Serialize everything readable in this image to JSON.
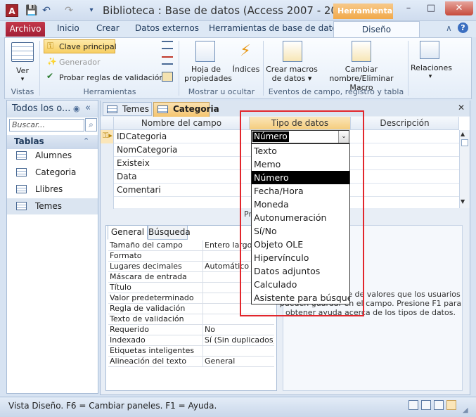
{
  "titlebar": {
    "title": "Biblioteca : Base de datos (Access 2007 - 2010)",
    "context_tab": "Herramienta...",
    "app_icon_letter": "A"
  },
  "ribbon_tabs": [
    "Archivo",
    "Inicio",
    "Crear",
    "Datos externos",
    "Herramientas de base de datos",
    "Diseño"
  ],
  "ribbon": {
    "ver": "Ver",
    "clave_principal": "Clave principal",
    "generador": "Generador",
    "probar_reglas": "Probar reglas de validación",
    "hoja_propiedades": [
      "Hoja de",
      "propiedades"
    ],
    "indices": "Índices",
    "crear_macros": [
      "Crear macros",
      "de datos ▾"
    ],
    "cambiar_macro": [
      "Cambiar",
      "nombre/Eliminar Macro"
    ],
    "relaciones": "Relaciones",
    "groups": [
      "Vistas",
      "Herramientas",
      "Mostrar u ocultar",
      "Eventos de campo, registro y tabla"
    ]
  },
  "nav": {
    "title": "Todos los o...",
    "search_placeholder": "Buscar...",
    "section": "Tablas",
    "items": [
      "Alumnes",
      "Categoria",
      "Llibres",
      "Temes"
    ]
  },
  "doc_tabs": [
    "Temes",
    "Categoria"
  ],
  "grid": {
    "headers": [
      "Nombre del campo",
      "Tipo de datos",
      "Descripción"
    ],
    "fields": [
      "IDCategoria",
      "NomCategoria",
      "Existeix",
      "Data",
      "Comentari"
    ],
    "current_type": "Número",
    "partial_label": "Pr"
  },
  "dropdown_options": [
    "Texto",
    "Memo",
    "Número",
    "Fecha/Hora",
    "Moneda",
    "Autonumeración",
    "Sí/No",
    "Objeto OLE",
    "Hipervínculo",
    "Datos adjuntos",
    "Calculado",
    "Asistente para búsque"
  ],
  "props": {
    "tabs": [
      "General",
      "Búsqueda"
    ],
    "rows": [
      {
        "label": "Tamaño del campo",
        "value": "Entero largo"
      },
      {
        "label": "Formato",
        "value": ""
      },
      {
        "label": "Lugares decimales",
        "value": "Automático"
      },
      {
        "label": "Máscara de entrada",
        "value": ""
      },
      {
        "label": "Título",
        "value": ""
      },
      {
        "label": "Valor predeterminado",
        "value": ""
      },
      {
        "label": "Regla de validación",
        "value": ""
      },
      {
        "label": "Texto de validación",
        "value": ""
      },
      {
        "label": "Requerido",
        "value": "No"
      },
      {
        "label": "Indexado",
        "value": "Sí (Sin duplicados)"
      },
      {
        "label": "Etiquetas inteligentes",
        "value": ""
      },
      {
        "label": "Alineación del texto",
        "value": "General"
      }
    ]
  },
  "help_text": "determina la clase de valores que los usuarios pueden guardar en el campo. Presione F1 para obtener ayuda acerca de los tipos de datos.",
  "status": {
    "text": "Vista Diseño.  F6 = Cambiar paneles.  F1 = Ayuda."
  },
  "colors": {
    "highlight": "#000000",
    "annotation_red": "#e2262c",
    "archivo_tab": "#a21e36"
  }
}
